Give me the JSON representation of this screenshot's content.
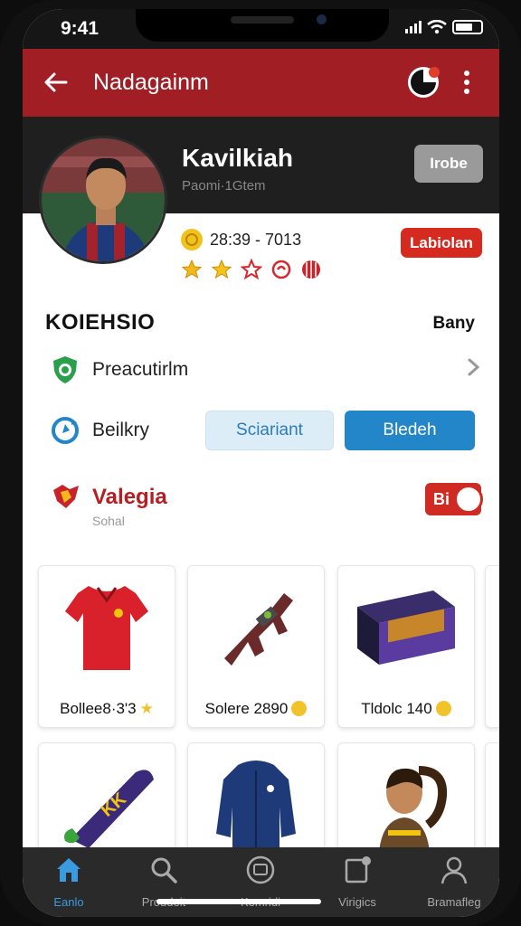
{
  "status_bar": {
    "time": "9:41"
  },
  "app_bar": {
    "title": "Nadagainm"
  },
  "profile": {
    "name": "Kavilkiah",
    "subtitle": "Paomi·1Gtem",
    "follow_label": "Irobe"
  },
  "stats": {
    "value": "28:39 - 7013",
    "level_label": "Labiolan",
    "achievement_icons": [
      "star-icon",
      "star-icon",
      "star-outline-icon",
      "swirl-icon",
      "ball-icon"
    ]
  },
  "section": {
    "title": "KOIEHSIO",
    "link_label": "Bany"
  },
  "rows": {
    "protection_label": "Preacutirlm",
    "bulkry_label": "Beilkry",
    "secondary_button": "Sciariant",
    "primary_button": "Bledeh"
  },
  "value_row": {
    "title": "Valegia",
    "subtitle": "Sohal",
    "pill_label": "Bi"
  },
  "products": [
    {
      "label": "Bollee8·3'3",
      "icon": "shirt-icon"
    },
    {
      "label": "Solere 2890",
      "icon": "gun-icon"
    },
    {
      "label": "Tldolc 140",
      "icon": "box-icon"
    },
    {
      "label": "",
      "icon": "toy-icon"
    },
    {
      "label": "",
      "icon": "jacket-icon"
    },
    {
      "label": "",
      "icon": "figure-icon"
    }
  ],
  "bottom_nav": [
    {
      "label": "Eanlo",
      "icon": "home-icon",
      "active": true
    },
    {
      "label": "Proudeit",
      "icon": "search-icon",
      "active": false
    },
    {
      "label": "Kemridi",
      "icon": "tv-icon",
      "active": false
    },
    {
      "label": "Virigics",
      "icon": "tablet-icon",
      "active": false
    },
    {
      "label": "Bramafleg",
      "icon": "profile-icon",
      "active": false
    }
  ],
  "colors": {
    "app_bar": "#a11e25",
    "header": "#1f1f1f",
    "primary_button": "#2386c8",
    "secondary_button": "#dcedf8",
    "level_badge": "#d42a20",
    "active_nav": "#3a9be0"
  }
}
